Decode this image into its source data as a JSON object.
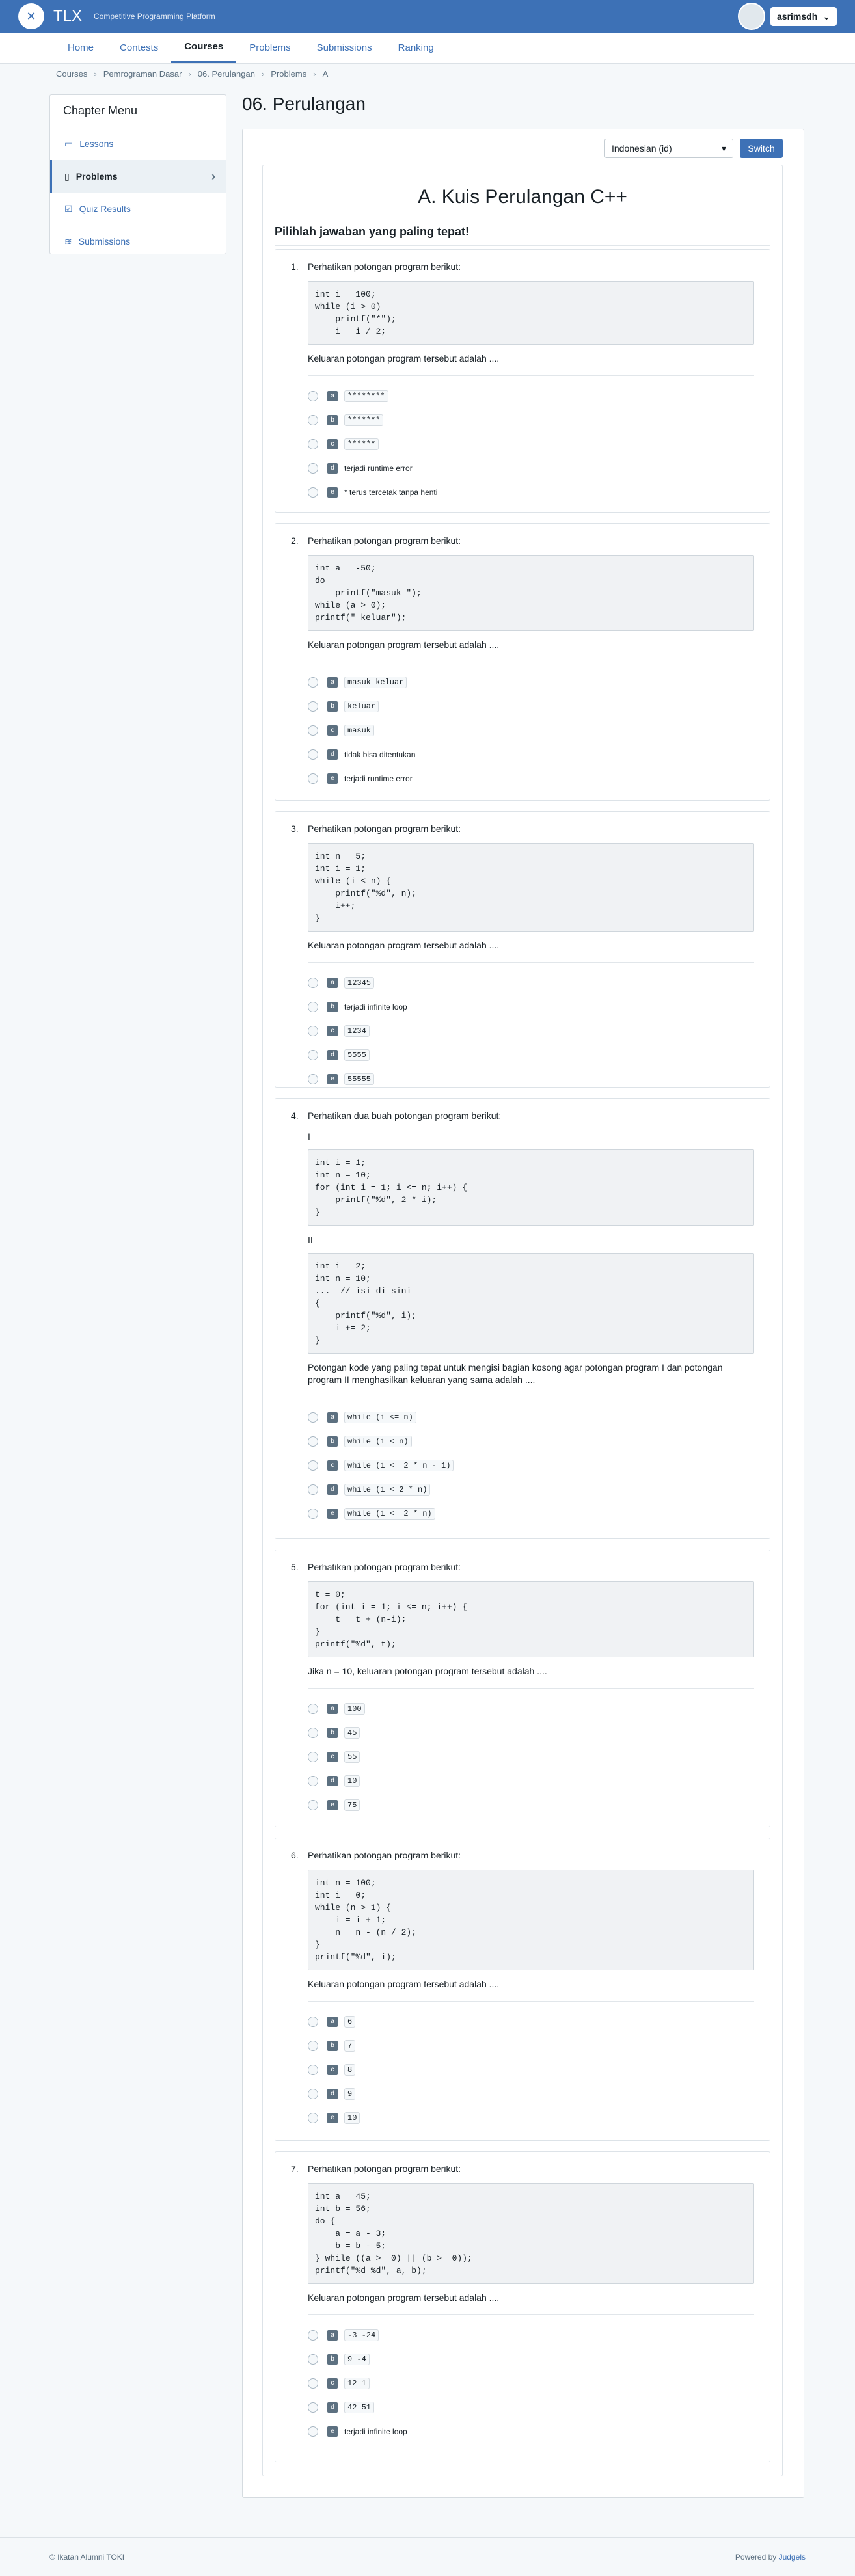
{
  "header": {
    "brand": "TLX",
    "tagline": "Competitive Programming Platform",
    "username": "asrimsdh",
    "nav": [
      "Home",
      "Contests",
      "Courses",
      "Problems",
      "Submissions",
      "Ranking"
    ],
    "active_nav": "Courses"
  },
  "breadcrumb": [
    "Courses",
    "Pemrograman Dasar",
    "06. Perulangan",
    "Problems",
    "A"
  ],
  "sidebar": {
    "title": "Chapter Menu",
    "items": [
      {
        "label": "Lessons",
        "icon": "book-icon"
      },
      {
        "label": "Problems",
        "icon": "problems-icon"
      },
      {
        "label": "Quiz Results",
        "icon": "results-icon"
      },
      {
        "label": "Submissions",
        "icon": "layers-icon"
      }
    ],
    "active_item": "Problems"
  },
  "page": {
    "title": "06. Perulangan",
    "language": "Indonesian (id)",
    "switch_label": "Switch"
  },
  "quiz": {
    "title": "A. Kuis Perulangan C++",
    "subtitle": "Pilihlah jawaban yang paling tepat!",
    "questions": [
      {
        "num": "1.",
        "intro": "Perhatikan potongan program berikut:",
        "code": "int i = 100;\nwhile (i > 0)\n    printf(\"*\");\n    i = i / 2;",
        "question": "Keluaran potongan program tersebut adalah ....",
        "options": [
          {
            "letter": "a",
            "text": "********",
            "mono": true
          },
          {
            "letter": "b",
            "text": "*******",
            "mono": true
          },
          {
            "letter": "c",
            "text": "******",
            "mono": true
          },
          {
            "letter": "d",
            "text": "terjadi runtime error",
            "mono": false
          },
          {
            "letter": "e",
            "text": "* terus tercetak tanpa henti",
            "mono": false
          }
        ]
      },
      {
        "num": "2.",
        "intro": "Perhatikan potongan program berikut:",
        "code": "int a = -50;\ndo\n    printf(\"masuk \");\nwhile (a > 0);\nprintf(\" keluar\");",
        "question": "Keluaran potongan program tersebut adalah ....",
        "options": [
          {
            "letter": "a",
            "text": "masuk keluar",
            "mono": true
          },
          {
            "letter": "b",
            "text": " keluar",
            "mono": true
          },
          {
            "letter": "c",
            "text": "masuk",
            "mono": true
          },
          {
            "letter": "d",
            "text": "tidak bisa ditentukan",
            "mono": false
          },
          {
            "letter": "e",
            "text": "terjadi runtime error",
            "mono": false
          }
        ]
      },
      {
        "num": "3.",
        "intro": "Perhatikan potongan program berikut:",
        "code": "int n = 5;\nint i = 1;\nwhile (i < n) {\n    printf(\"%d\", n);\n    i++;\n}",
        "question": "Keluaran potongan program tersebut adalah ....",
        "options": [
          {
            "letter": "a",
            "text": "12345",
            "mono": true
          },
          {
            "letter": "b",
            "text": "terjadi infinite loop",
            "mono": false
          },
          {
            "letter": "c",
            "text": "1234",
            "mono": true
          },
          {
            "letter": "d",
            "text": "5555",
            "mono": true
          },
          {
            "letter": "e",
            "text": "55555",
            "mono": true
          }
        ]
      },
      {
        "num": "4.",
        "intro": "Perhatikan dua buah potongan program berikut:",
        "label1": "I",
        "code": "int i = 1;\nint n = 10;\nfor (int i = 1; i <= n; i++) {\n    printf(\"%d\", 2 * i);\n}",
        "label2": "II",
        "code2": "int i = 2;\nint n = 10;\n...  // isi di sini\n{\n    printf(\"%d\", i);\n    i += 2;\n}",
        "question": "Potongan kode yang paling tepat untuk mengisi bagian kosong agar potongan program I dan potongan program II menghasilkan keluaran yang sama adalah ....",
        "options": [
          {
            "letter": "a",
            "text": "while (i <= n)",
            "mono": true
          },
          {
            "letter": "b",
            "text": "while (i < n)",
            "mono": true
          },
          {
            "letter": "c",
            "text": "while (i <= 2 * n - 1)",
            "mono": true
          },
          {
            "letter": "d",
            "text": "while (i < 2 * n)",
            "mono": true
          },
          {
            "letter": "e",
            "text": "while (i <= 2 * n)",
            "mono": true
          }
        ]
      },
      {
        "num": "5.",
        "intro": "Perhatikan potongan program berikut:",
        "code": "t = 0;\nfor (int i = 1; i <= n; i++) {\n    t = t + (n-i);\n}\nprintf(\"%d\", t);",
        "question": "Jika n = 10, keluaran potongan program tersebut adalah ....",
        "options": [
          {
            "letter": "a",
            "text": "100",
            "mono": true
          },
          {
            "letter": "b",
            "text": "45",
            "mono": true
          },
          {
            "letter": "c",
            "text": "55",
            "mono": true
          },
          {
            "letter": "d",
            "text": "10",
            "mono": true
          },
          {
            "letter": "e",
            "text": "75",
            "mono": true
          }
        ]
      },
      {
        "num": "6.",
        "intro": "Perhatikan potongan program berikut:",
        "code": "int n = 100;\nint i = 0;\nwhile (n > 1) {\n    i = i + 1;\n    n = n - (n / 2);\n}\nprintf(\"%d\", i);",
        "question": "Keluaran potongan program tersebut adalah ....",
        "options": [
          {
            "letter": "a",
            "text": "6",
            "mono": true
          },
          {
            "letter": "b",
            "text": "7",
            "mono": true
          },
          {
            "letter": "c",
            "text": "8",
            "mono": true
          },
          {
            "letter": "d",
            "text": "9",
            "mono": true
          },
          {
            "letter": "e",
            "text": "10",
            "mono": true
          }
        ]
      },
      {
        "num": "7.",
        "intro": "Perhatikan potongan program berikut:",
        "code": "int a = 45;\nint b = 56;\ndo {\n    a = a - 3;\n    b = b - 5;\n} while ((a >= 0) || (b >= 0));\nprintf(\"%d %d\", a, b);",
        "question": "Keluaran potongan program tersebut adalah ....",
        "options": [
          {
            "letter": "a",
            "text": "-3 -24",
            "mono": true
          },
          {
            "letter": "b",
            "text": "9 -4",
            "mono": true
          },
          {
            "letter": "c",
            "text": "12 1",
            "mono": true
          },
          {
            "letter": "d",
            "text": "42 51",
            "mono": true
          },
          {
            "letter": "e",
            "text": "terjadi infinite loop",
            "mono": false
          }
        ]
      }
    ]
  },
  "footer": {
    "copyright": "© Ikatan Alumni TOKI",
    "powered_prefix": "Powered by ",
    "powered_link": "Judgels"
  }
}
